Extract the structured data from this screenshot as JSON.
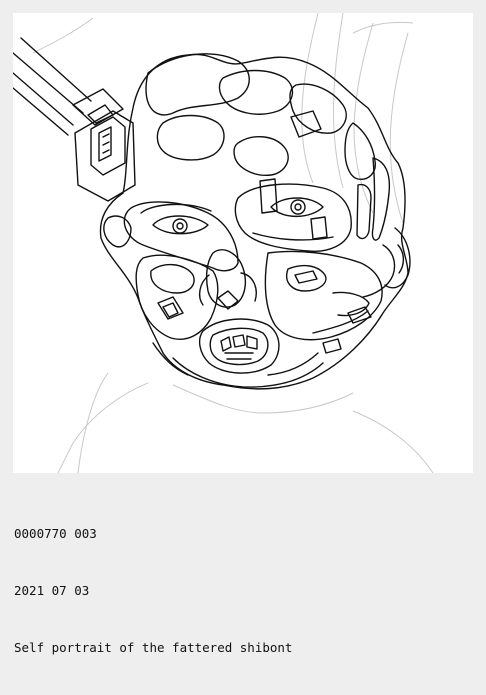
{
  "artwork": {
    "description_icon": "line-drawing-portrait",
    "stroke_color": "#111111",
    "faint_stroke_color": "#c8c8c8",
    "background": "#ffffff"
  },
  "caption": {
    "id_line": "0000770 003",
    "date_line": "2021 07 03",
    "title_line": "Self portrait of the fattered shibont"
  },
  "colors": {
    "frame": "#eeeeee",
    "text": "#111111"
  }
}
